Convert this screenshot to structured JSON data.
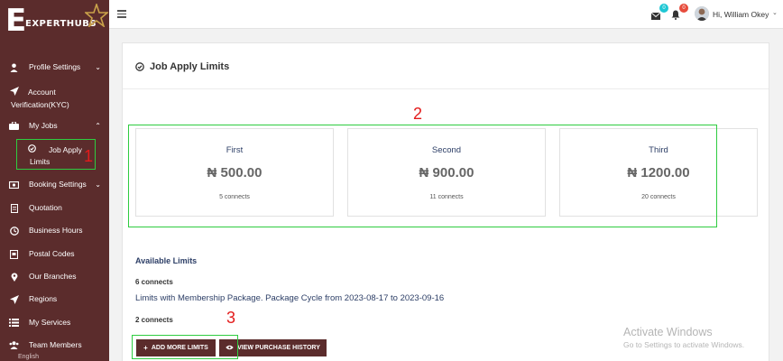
{
  "brand": {
    "logo_text": "EXPERTHUBS",
    "logo_letter": "E"
  },
  "sidebar": {
    "items": [
      {
        "label": "Profile Settings",
        "icon": "user-icon",
        "caret": "⌄"
      },
      {
        "label": "Account Verification(KYC)",
        "icon": "paper-plane-icon"
      },
      {
        "label": "My Jobs",
        "icon": "briefcase-icon",
        "caret": "⌃"
      },
      {
        "label": "Booking Settings",
        "icon": "money-icon",
        "caret": "⌄"
      },
      {
        "label": "Quotation",
        "icon": "document-icon"
      },
      {
        "label": "Business Hours",
        "icon": "clock-icon"
      },
      {
        "label": "Postal Codes",
        "icon": "postal-icon"
      },
      {
        "label": "Our Branches",
        "icon": "map-pin-icon"
      },
      {
        "label": "Regions",
        "icon": "paper-plane-icon"
      },
      {
        "label": "My Services",
        "icon": "list-icon"
      },
      {
        "label": "Team Members",
        "icon": "team-icon"
      }
    ],
    "sub_item": {
      "label": "Job Apply Limits",
      "icon": "check-circle-icon"
    },
    "language": "English"
  },
  "header": {
    "mail_badge": "0",
    "bell_badge": "0",
    "greeting": "Hi, William Okey",
    "caret": "⌄",
    "colors": {
      "mail_badge": "#1fc7d4",
      "bell_badge": "#e74c3c"
    }
  },
  "page": {
    "title": "Job Apply Limits",
    "tiers": [
      {
        "name": "First",
        "price": "₦ 500.00",
        "connects": "5 connects"
      },
      {
        "name": "Second",
        "price": "₦ 900.00",
        "connects": "11 connects"
      },
      {
        "name": "Third",
        "price": "₦ 1200.00",
        "connects": "20 connects"
      }
    ],
    "available_title": "Available Limits",
    "connects_a": "6 connects",
    "package_line": "Limits with Membership Package. Package Cycle from 2023-08-17 to 2023-09-16",
    "connects_b": "2 connects",
    "add_button": "ADD MORE LIMITS",
    "history_button": "VIEW PURCHASE HISTORY"
  },
  "annotations": {
    "one": "1",
    "two": "2",
    "three": "3"
  },
  "watermark": {
    "line1": "Activate Windows",
    "line2": "Go to Settings to activate Windows."
  },
  "colors": {
    "sidebar": "#5b2c2c",
    "annotation_box": "#2ecc40",
    "annotation_text": "#e31b1b",
    "accent_text": "#2c3e66"
  }
}
